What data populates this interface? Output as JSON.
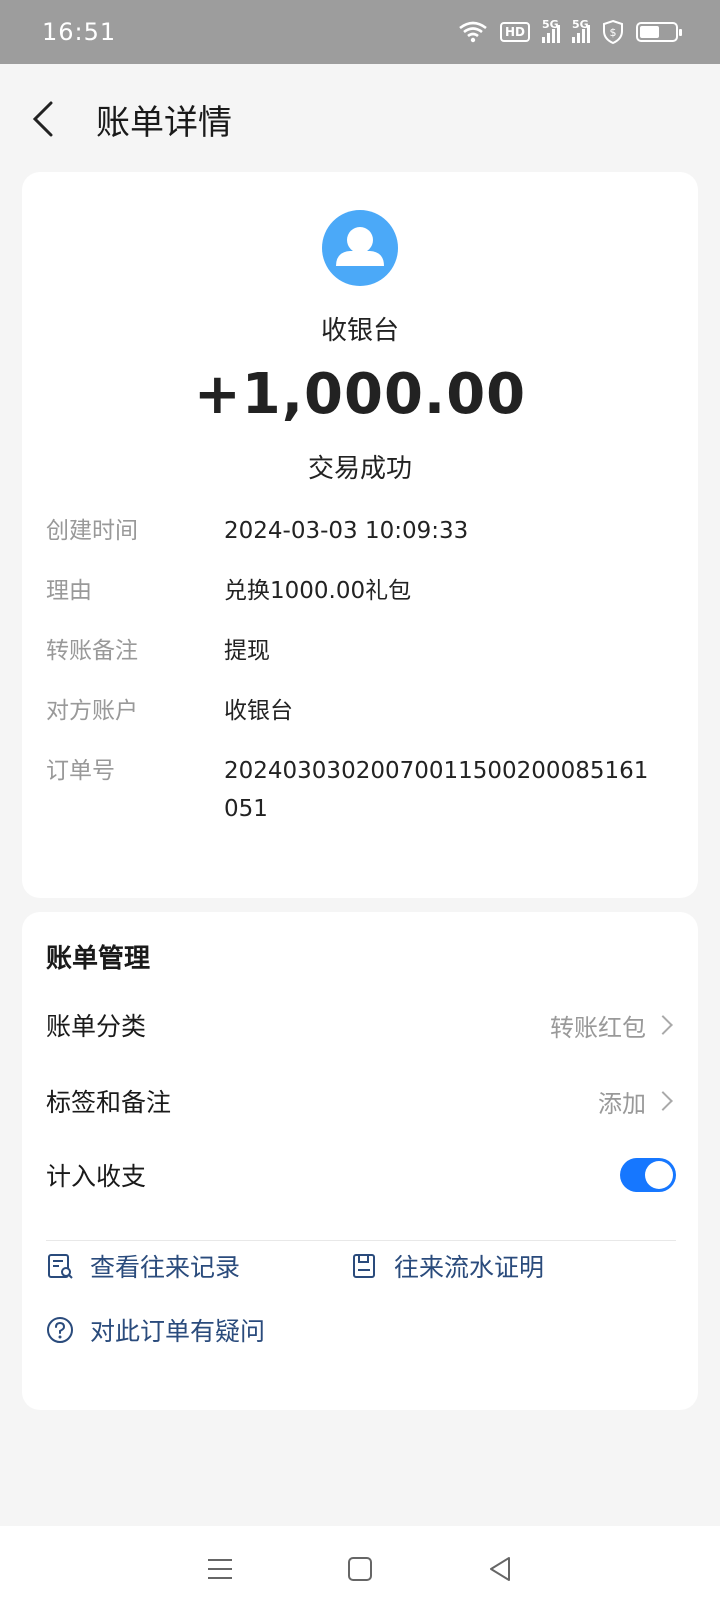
{
  "status_bar": {
    "time": "16:51",
    "hd_label": "HD",
    "signal_label_1": "5G",
    "signal_label_2": "5G",
    "battery_level": 0.55
  },
  "header": {
    "title": "账单详情"
  },
  "transaction": {
    "payee": "收银台",
    "amount": "+1,000.00",
    "status": "交易成功",
    "details": [
      {
        "label": "创建时间",
        "value": "2024-03-03 10:09:33"
      },
      {
        "label": "理由",
        "value": "兑换1000.00礼包"
      },
      {
        "label": "转账备注",
        "value": "提现"
      },
      {
        "label": "对方账户",
        "value": "收银台"
      },
      {
        "label": "订单号",
        "value": "20240303020070011500200085161051"
      }
    ]
  },
  "manage": {
    "title": "账单管理",
    "category_label": "账单分类",
    "category_value": "转账红包",
    "tags_label": "标签和备注",
    "tags_value": "添加",
    "include_label": "计入收支",
    "include_enabled": true,
    "links": {
      "history": "查看往来记录",
      "proof": "往来流水证明",
      "question": "对此订单有疑问"
    }
  },
  "colors": {
    "accent": "#1677ff",
    "avatar_bg": "#4ba9f8",
    "link": "#2a4b7c",
    "muted": "#999999"
  }
}
